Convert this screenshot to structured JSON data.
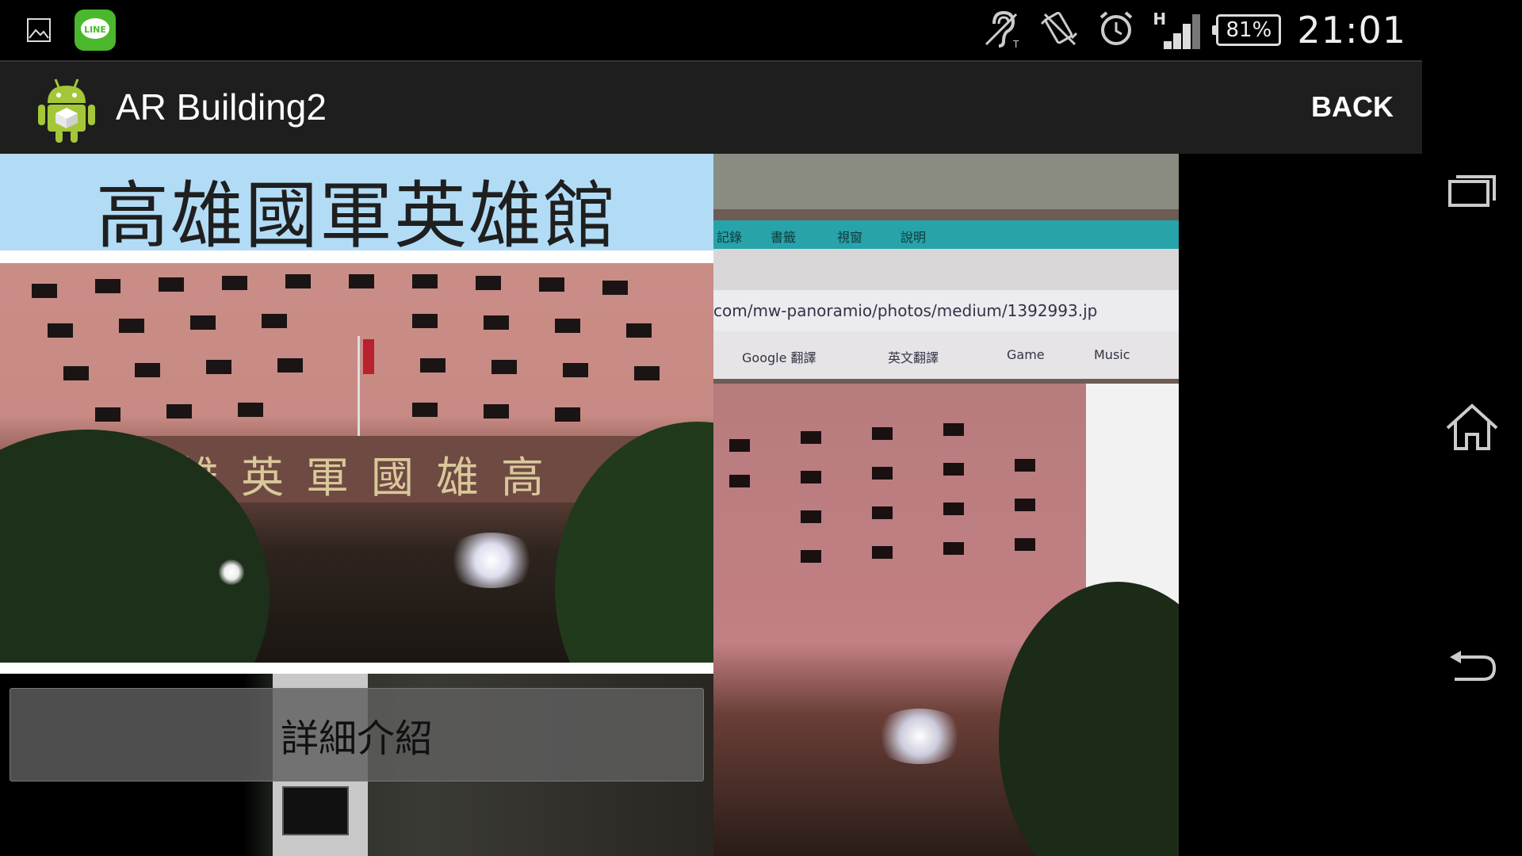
{
  "status_bar": {
    "time": "21:01",
    "battery": "81%",
    "network_type": "H",
    "notification_icons": [
      "gallery-icon",
      "line-icon"
    ],
    "status_icons": [
      "hearing-aid-icon",
      "vibrate-icon",
      "alarm-icon",
      "signal-icon",
      "battery-icon"
    ],
    "line_label": "LINE"
  },
  "action_bar": {
    "title": "AR Building2",
    "back_label": "BACK"
  },
  "main": {
    "building_name": "高雄國軍英雄館",
    "detail_button_label": "詳細介紹",
    "sign_text": "館雄英軍國雄高"
  },
  "camera_view": {
    "menu_items": [
      "記錄",
      "書籤",
      "視窗",
      "說明"
    ],
    "url_fragment": "com/mw-panoramio/photos/medium/1392993.jp",
    "bookmarks": [
      "Google 翻譯",
      "英文翻譯",
      "Game",
      "Music"
    ]
  },
  "nav_bar": {
    "buttons": [
      "recent-apps",
      "home",
      "back"
    ]
  },
  "colors": {
    "title_banner": "#b2dcf6",
    "action_bar": "#1e1e1e",
    "button": "#5f5f5f"
  }
}
